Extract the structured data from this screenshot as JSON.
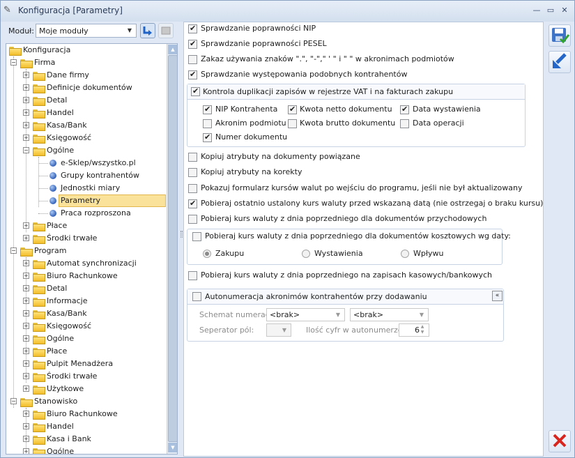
{
  "window": {
    "title": "Konfiguracja [Parametry]",
    "icons": {
      "app": "pen-icon",
      "minimize": "minimize-icon",
      "maximize": "maximize-icon",
      "close": "close-icon"
    }
  },
  "module": {
    "label": "Moduł:",
    "value": "Moje moduły"
  },
  "tree": {
    "root": "Konfiguracja",
    "firma": {
      "label": "Firma",
      "items": [
        "Dane firmy",
        "Definicje dokumentów",
        "Detal",
        "Handel",
        "Kasa/Bank",
        "Księgowość"
      ],
      "ogolne": {
        "label": "Ogólne",
        "items": [
          "e-Sklep/wszystko.pl",
          "Grupy kontrahentów",
          "Jednostki miary",
          "Parametry",
          "Praca rozproszona"
        ]
      },
      "after": [
        "Płace",
        "Środki trwałe"
      ]
    },
    "program": {
      "label": "Program",
      "items": [
        "Automat synchronizacji",
        "Biuro Rachunkowe",
        "Detal",
        "Informacje",
        "Kasa/Bank",
        "Księgowość",
        "Ogólne",
        "Płace",
        "Pulpit Menadżera",
        "Środki trwałe",
        "Użytkowe"
      ]
    },
    "stanowisko": {
      "label": "Stanowisko",
      "items": [
        "Biuro Rachunkowe",
        "Handel",
        "Kasa i Bank",
        "Ogólne"
      ]
    }
  },
  "settings": {
    "nip": {
      "label": "Sprawdzanie poprawności NIP",
      "checked": true
    },
    "pesel": {
      "label": "Sprawdzanie poprawności PESEL",
      "checked": true
    },
    "znaki": {
      "label": "Zakaz używania znaków \".\", \"-\",\" ' \" i \" \" w akronimach podmiotów",
      "checked": false
    },
    "podobni": {
      "label": "Sprawdzanie występowania podobnych kontrahentów",
      "checked": true
    },
    "duplikacja": {
      "label": "Kontrola duplikacji zapisów w rejestrze VAT i na fakturach zakupu",
      "checked": true,
      "options": {
        "nip_kontrahenta": "NIP Kontrahenta",
        "akronim": "Akronim podmiotu",
        "numer": "Numer dokumentu",
        "netto": "Kwota netto dokumentu",
        "brutto": "Kwota brutto dokumentu",
        "wystawienia": "Data wystawienia",
        "operacji": "Data operacji"
      }
    },
    "atrybuty_powiazane": {
      "label": "Kopiuj atrybuty na dokumenty powiązane",
      "checked": false
    },
    "atrybuty_korekty": {
      "label": "Kopiuj atrybuty na korekty",
      "checked": false
    },
    "formularz_kursow": {
      "label": "Pokazuj formularz kursów walut po wejściu do programu, jeśli nie był aktualizowany",
      "checked": false
    },
    "ostatni_kurs": {
      "label": "Pobieraj ostatnio ustalony kurs waluty przed wskazaną datą (nie ostrzegaj o braku kursu)",
      "checked": true
    },
    "kurs_przychodowe": {
      "label": "Pobieraj kurs waluty z dnia poprzedniego dla dokumentów przychodowych",
      "checked": false
    },
    "kurs_kosztowe": {
      "label": "Pobieraj kurs waluty z dnia poprzedniego dla dokumentów kosztowych wg daty:",
      "checked": false,
      "radios": [
        "Zakupu",
        "Wystawienia",
        "Wpływu"
      ],
      "selected": "Zakupu"
    },
    "kurs_kasowe": {
      "label": "Pobieraj kurs waluty z dnia poprzedniego na zapisach kasowych/bankowych",
      "checked": false
    },
    "autonumeracja": {
      "label": "Autonumeracja akronimów kontrahentów przy dodawaniu",
      "checked": false,
      "schemat_label": "Schemat numeracji:",
      "schemat1": "<brak>",
      "schemat2": "<brak>",
      "separator_label": "Seperator pól:",
      "ilosc_label": "Ilość cyfr w autonumerze:",
      "ilosc_value": "6"
    }
  },
  "toolbar": {
    "save": "save-icon",
    "undo": "undo-icon",
    "close": "cancel-icon"
  }
}
